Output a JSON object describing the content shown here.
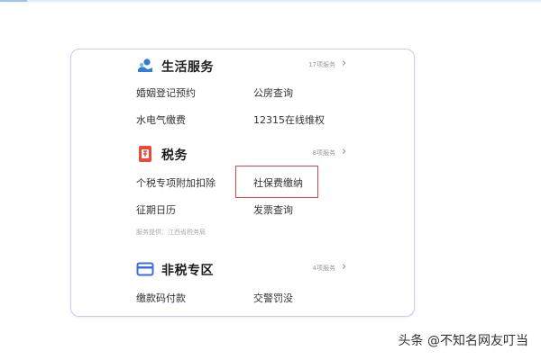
{
  "sections": [
    {
      "icon": "life-service-icon",
      "title": "生活服务",
      "count": "17项服务",
      "items": [
        "婚姻登记预约",
        "公房查询",
        "水电气缴费",
        "12315在线维权"
      ]
    },
    {
      "icon": "tax-icon",
      "title": "税务",
      "count": "8项服务",
      "items": [
        "个税专项附加扣除",
        "社保费缴纳",
        "征期日历",
        "发票查询"
      ],
      "provider": "服务提供：江西省税务局"
    },
    {
      "icon": "card-icon",
      "title": "非税专区",
      "count": "4项服务",
      "items": [
        "缴款码付款",
        "交警罚没"
      ]
    }
  ],
  "chevron": "›",
  "highlighted_item": "社保费缴纳",
  "watermark": "头条 @不知名网友叮当",
  "colors": {
    "card_border": "#c9cdf2",
    "highlight": "#e04343",
    "life_icon": "#2f7fd8",
    "tax_icon": "#e64a3b",
    "card_icon": "#3b6fd6"
  }
}
